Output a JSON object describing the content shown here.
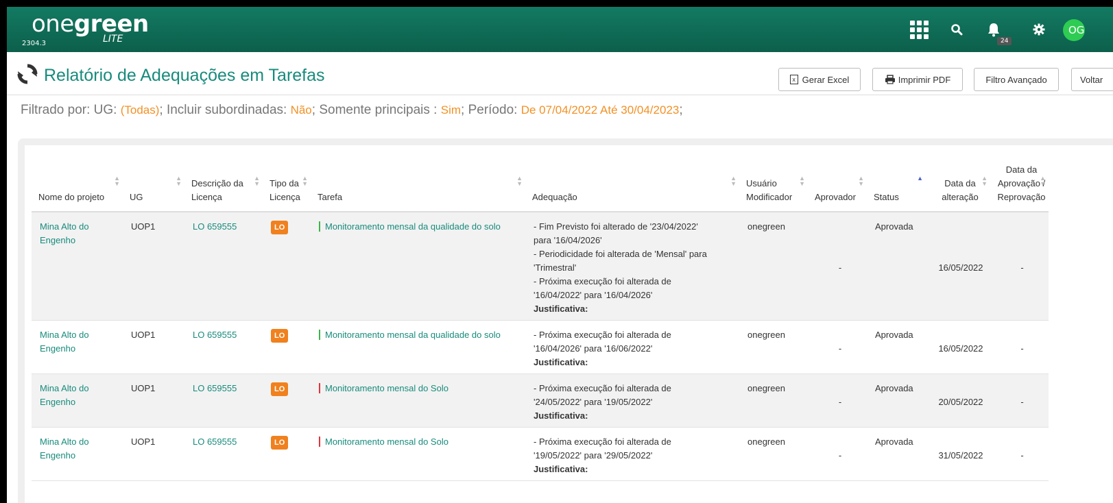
{
  "app": {
    "logo_one": "one",
    "logo_green": "green",
    "logo_lite": "LITE",
    "version": "2304.3",
    "notifications_count": "24",
    "avatar_initials": "OG"
  },
  "page": {
    "title": "Relatório de Adequações em Tarefas",
    "buttons": {
      "excel": "Gerar Excel",
      "pdf": "Imprimir PDF",
      "filter": "Filtro Avançado",
      "back": "Voltar"
    }
  },
  "filter": {
    "prefix": "Filtrado por: UG: ",
    "ug_value": "(Todas)",
    "sub_label": "; Incluir subordinadas: ",
    "sub_value": "Não",
    "main_label": "; Somente principais : ",
    "main_value": "Sim",
    "period_label": "; Período: ",
    "period_value": "De 07/04/2022 Até 30/04/2023",
    "end": ";"
  },
  "table": {
    "headers": {
      "projeto": "Nome do projeto",
      "ug": "UG",
      "descricao_1": "Descrição da",
      "descricao_2": "Licença",
      "tipo_1": "Tipo da",
      "tipo_2": "Licença",
      "tarefa": "Tarefa",
      "adequacao": "Adequação",
      "usuario_1": "Usuário",
      "usuario_2": "Modificador",
      "aprovador": "Aprovador",
      "status": "Status",
      "data_alt_1": "Data da",
      "data_alt_2": "alteração",
      "data_apr_1": "Data da",
      "data_apr_2": "Aprovação /",
      "data_apr_3": "Reprovação"
    },
    "rows": [
      {
        "projeto_1": "Mina Alto do",
        "projeto_2": "Engenho",
        "ug": "UOP1",
        "descricao": "LO 659555",
        "tipo": "LO",
        "tarefa": "Monitoramento mensal da qualidade do solo",
        "tarefa_color": "#3cb44b",
        "adequacao": [
          "- Fim Previsto foi alterado de '23/04/2022'",
          "para '16/04/2026'",
          "- Periodicidade foi alterada de 'Mensal' para",
          "'Trimestral'",
          "- Próxima execução foi alterada de",
          "'16/04/2022' para '16/04/2026'"
        ],
        "justificativa": "Justificativa:",
        "usuario": "onegreen",
        "aprovador": "-",
        "status": "Aprovada",
        "data_alteracao": "16/05/2022",
        "data_aprovacao": "-"
      },
      {
        "projeto_1": "Mina Alto do",
        "projeto_2": "Engenho",
        "ug": "UOP1",
        "descricao": "LO 659555",
        "tipo": "LO",
        "tarefa": "Monitoramento mensal da qualidade do solo",
        "tarefa_color": "#3cb44b",
        "adequacao": [
          "- Próxima execução foi alterada de",
          "'16/04/2026' para '16/06/2022'"
        ],
        "justificativa": "Justificativa:",
        "usuario": "onegreen",
        "aprovador": "-",
        "status": "Aprovada",
        "data_alteracao": "16/05/2022",
        "data_aprovacao": "-"
      },
      {
        "projeto_1": "Mina Alto do",
        "projeto_2": "Engenho",
        "ug": "UOP1",
        "descricao": "LO 659555",
        "tipo": "LO",
        "tarefa": "Monitoramento mensal do Solo",
        "tarefa_color": "#e0343d",
        "adequacao": [
          "- Próxima execução foi alterada de",
          "'24/05/2022' para '19/05/2022'"
        ],
        "justificativa": "Justificativa:",
        "usuario": "onegreen",
        "aprovador": "-",
        "status": "Aprovada",
        "data_alteracao": "20/05/2022",
        "data_aprovacao": "-"
      },
      {
        "projeto_1": "Mina Alto do",
        "projeto_2": "Engenho",
        "ug": "UOP1",
        "descricao": "LO 659555",
        "tipo": "LO",
        "tarefa": "Monitoramento mensal do Solo",
        "tarefa_color": "#e0343d",
        "adequacao": [
          "- Próxima execução foi alterada de",
          "'19/05/2022' para '29/05/2022'"
        ],
        "justificativa": "Justificativa:",
        "usuario": "onegreen",
        "aprovador": "-",
        "status": "Aprovada",
        "data_alteracao": "31/05/2022",
        "data_aprovacao": "-"
      }
    ]
  },
  "icons": {
    "apps": "apps-grid-icon",
    "search": "search-icon",
    "bell": "bell-icon",
    "settings": "gear-icon",
    "refresh": "refresh-icon",
    "excel": "excel-icon",
    "print": "printer-icon"
  },
  "colors": {
    "brand": "#0c5f4b",
    "title": "#178b7c",
    "accent": "#f39125",
    "lo_badge": "#f0811e"
  }
}
